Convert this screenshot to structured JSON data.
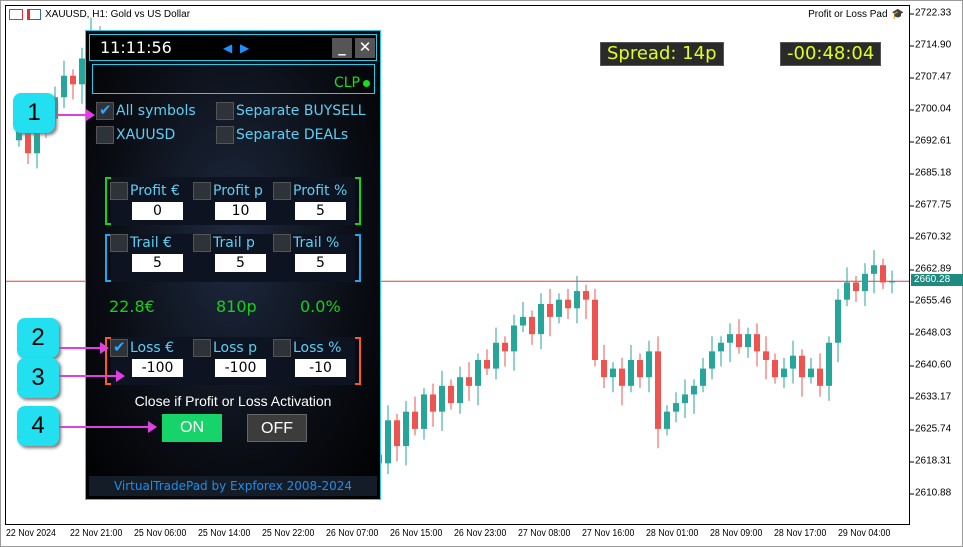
{
  "window": {
    "title": "XAUUSD, H1:  Gold vs US Dollar",
    "indicator": "Profit or Loss Pad"
  },
  "chart_data": {
    "type": "candlestick",
    "symbol": "XAUUSD",
    "timeframe": "H1",
    "current_price": "2660.28",
    "y_ticks": [
      "2722.33",
      "2714.90",
      "2707.47",
      "2700.04",
      "2692.61",
      "2685.18",
      "2677.75",
      "2670.32",
      "2662.89",
      "2655.46",
      "2648.03",
      "2640.60",
      "2633.17",
      "2625.74",
      "2618.31",
      "2610.88"
    ],
    "x_ticks": [
      "22 Nov 2024",
      "22 Nov 21:00",
      "25 Nov 06:00",
      "25 Nov 14:00",
      "25 Nov 22:00",
      "26 Nov 07:00",
      "26 Nov 15:00",
      "26 Nov 23:00",
      "27 Nov 08:00",
      "27 Nov 16:00",
      "28 Nov 01:00",
      "28 Nov 09:00",
      "28 Nov 17:00",
      "29 Nov 04:00"
    ],
    "closes": [
      2695,
      2690,
      2700,
      2698,
      2703,
      2708,
      2706,
      2712,
      2718,
      2715,
      2710,
      2705,
      2700,
      2695,
      2690,
      2688,
      2680,
      2675,
      2670,
      2665,
      2660,
      2655,
      2650,
      2648,
      2645,
      2640,
      2638,
      2635,
      2632,
      2630,
      2628,
      2625,
      2630,
      2628,
      2625,
      2622,
      2620,
      2625,
      2622,
      2620,
      2618,
      2628,
      2622,
      2630,
      2626,
      2634,
      2630,
      2636,
      2632,
      2638,
      2636,
      2642,
      2640,
      2646,
      2644,
      2650,
      2652,
      2648,
      2655,
      2652,
      2656,
      2654,
      2658,
      2656,
      2642,
      2638,
      2640,
      2636,
      2642,
      2638,
      2644,
      2626,
      2630,
      2632,
      2634,
      2636,
      2640,
      2644,
      2646,
      2648,
      2645,
      2648,
      2644,
      2642,
      2638,
      2640,
      2643,
      2638,
      2640,
      2636,
      2646,
      2656,
      2660,
      2658,
      2662,
      2664,
      2660,
      2660.28
    ],
    "up_color": "#26a69a",
    "down_color": "#ef5350",
    "price_line_color": "#e53935"
  },
  "spread": {
    "label": "Spread: 14p",
    "timer": "-00:48:04"
  },
  "panel": {
    "clock": "11:11:56",
    "minimize": "_",
    "close": "✕",
    "clp": "CLP",
    "options": [
      {
        "label": "All symbols",
        "checked": true
      },
      {
        "label": "Separate BUYSELL",
        "checked": false
      },
      {
        "label": "XAUUSD",
        "checked": false
      },
      {
        "label": "Separate DEALs",
        "checked": false
      }
    ],
    "profit": [
      {
        "label": "Profit €",
        "value": "0"
      },
      {
        "label": "Profit p",
        "value": "10"
      },
      {
        "label": "Profit %",
        "value": "5"
      }
    ],
    "trail": [
      {
        "label": "Trail €",
        "value": "5"
      },
      {
        "label": "Trail p",
        "value": "5"
      },
      {
        "label": "Trail %",
        "value": "5"
      }
    ],
    "stats": [
      "22.8€",
      "810p",
      "0.0%"
    ],
    "loss": [
      {
        "label": "Loss €",
        "value": "-100",
        "checked": true
      },
      {
        "label": "Loss p",
        "value": "-100"
      },
      {
        "label": "Loss %",
        "value": "-10"
      }
    ],
    "caption": "Close if Profit or Loss Activation",
    "on": "ON",
    "off": "OFF",
    "footer": "VirtualTradePad by Expforex 2008-2024"
  },
  "callouts": [
    "1",
    "2",
    "3",
    "4"
  ]
}
